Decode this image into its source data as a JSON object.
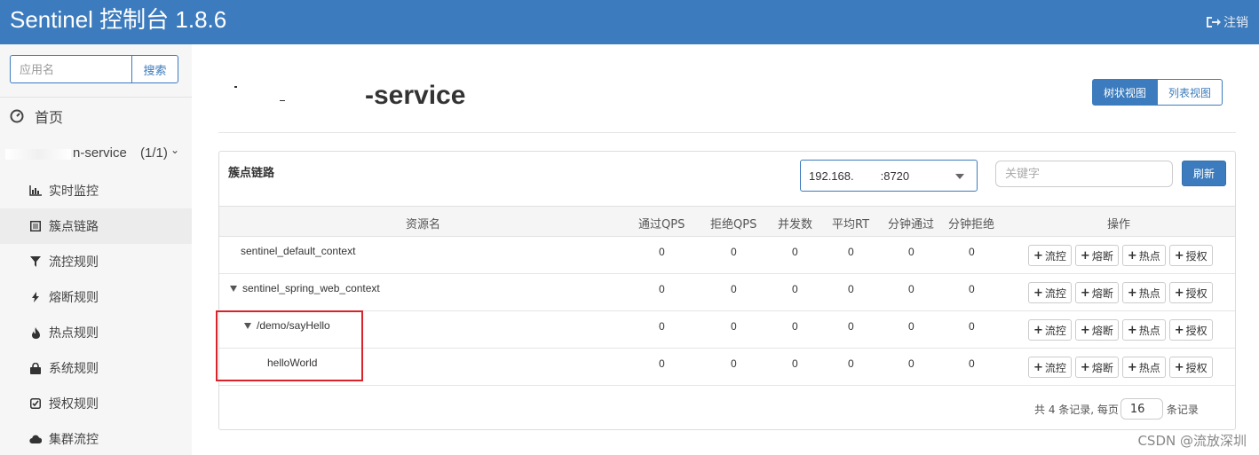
{
  "header": {
    "brand": "Sentinel 控制台 1.8.6",
    "logout_label": "注销"
  },
  "sidebar": {
    "search_placeholder": "应用名",
    "search_button": "搜索",
    "home_label": "首页",
    "app_name_visible": "n-service",
    "app_count": "(1/1)",
    "items": [
      {
        "label": "实时监控",
        "icon": "bar-chart-icon"
      },
      {
        "label": "簇点链路",
        "icon": "list-icon",
        "active": true
      },
      {
        "label": "流控规则",
        "icon": "filter-icon"
      },
      {
        "label": "熔断规则",
        "icon": "flash-icon"
      },
      {
        "label": "热点规则",
        "icon": "fire-icon"
      },
      {
        "label": "系统规则",
        "icon": "lock-icon"
      },
      {
        "label": "授权规则",
        "icon": "check-icon"
      },
      {
        "label": "集群流控",
        "icon": "cloud-icon"
      }
    ]
  },
  "main": {
    "page_title": "-service",
    "view_tree": "树状视图",
    "view_list": "列表视图",
    "panel_title": "簇点链路",
    "machine_part1": "192.168.",
    "machine_part2": ":8720",
    "keyword_placeholder": "关键字",
    "refresh_label": "刷新",
    "columns": [
      "资源名",
      "通过QPS",
      "拒绝QPS",
      "并发数",
      "平均RT",
      "分钟通过",
      "分钟拒绝",
      "操作"
    ],
    "rows": [
      {
        "name": "sentinel_default_context",
        "values": [
          "0",
          "0",
          "0",
          "0",
          "0",
          "0"
        ]
      },
      {
        "name": "sentinel_spring_web_context",
        "values": [
          "0",
          "0",
          "0",
          "0",
          "0",
          "0"
        ]
      },
      {
        "name": "/demo/sayHello",
        "values": [
          "0",
          "0",
          "0",
          "0",
          "0",
          "0"
        ]
      },
      {
        "name": "helloWorld",
        "values": [
          "0",
          "0",
          "0",
          "0",
          "0",
          "0"
        ]
      }
    ],
    "op_buttons": [
      "流控",
      "熔断",
      "热点",
      "授权"
    ],
    "pager_prefix": "共 4 条记录, 每页",
    "page_size": "16",
    "pager_suffix": "条记录"
  },
  "watermark": "CSDN @流放深圳",
  "colors": {
    "brand_blue": "#3c7bbd",
    "highlight_red": "#d9232a"
  }
}
